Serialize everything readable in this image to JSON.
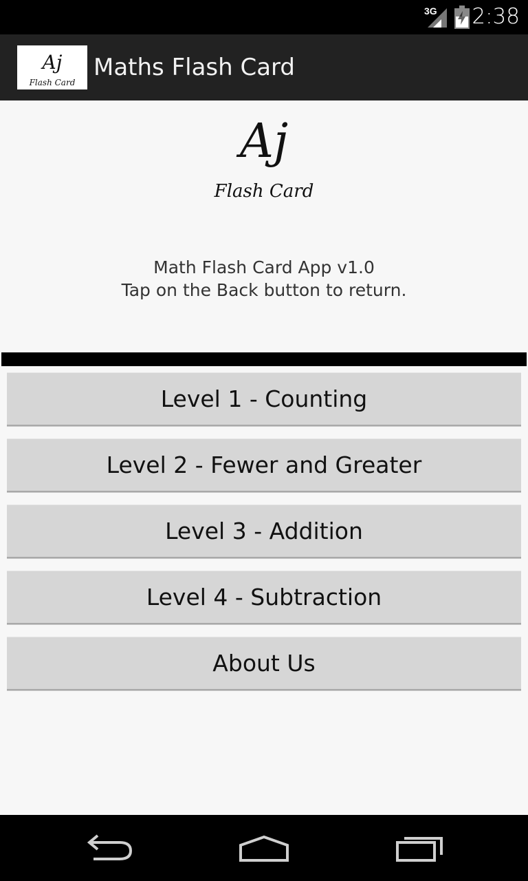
{
  "status_bar": {
    "network": "3G",
    "time": "2:38",
    "icons": [
      "signal-icon",
      "battery-icon"
    ]
  },
  "action_bar": {
    "title": "Maths Flash Card",
    "icon_text": {
      "monogram": "Aj",
      "subtitle": "Flash Card"
    }
  },
  "logo": {
    "monogram": "Aj",
    "subtitle": "Flash Card"
  },
  "about": {
    "line1": "Math Flash Card App v1.0",
    "line2": "Tap on the Back button to return."
  },
  "menu": {
    "level1": "Level 1 - Counting",
    "level2": "Level 2 - Fewer and Greater",
    "level3": "Level 3 - Addition",
    "level4": "Level 4 - Subtraction",
    "about_us": "About Us"
  },
  "nav_bar": {
    "icons": [
      "back-icon",
      "home-icon",
      "recents-icon"
    ]
  },
  "colors": {
    "status_bar": "#000000",
    "action_bar": "#222222",
    "background": "#f7f7f7",
    "button": "#d6d6d6"
  }
}
